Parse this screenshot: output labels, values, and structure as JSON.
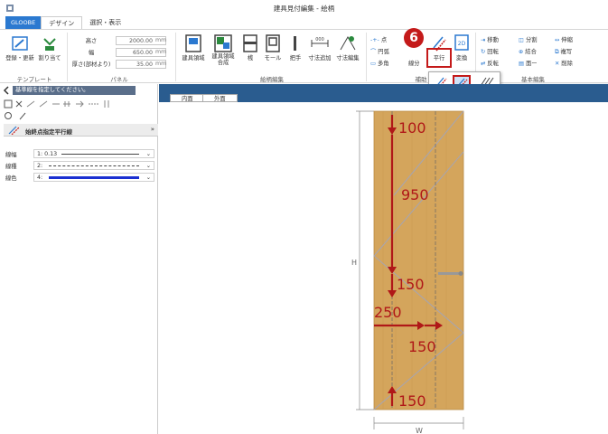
{
  "window": {
    "title": "建具見付編集 - 絵柄"
  },
  "tabs": {
    "file": "GLOOBE",
    "design": "デザイン",
    "view": "選択・表示"
  },
  "ribbon": {
    "template": {
      "register_label": "登録・更新",
      "assign_label": "割り当て",
      "group": "テンプレート"
    },
    "panel": {
      "height_label": "高さ",
      "height_value": "2000.00",
      "width_label": "幅",
      "width_value": "650.00",
      "thickness_label": "厚さ(部材より)",
      "thickness_value": "35.00",
      "unit": "mm",
      "group": "パネル"
    },
    "pattern": {
      "area_label": "建具領域",
      "area_composite_label": "建具領域\n合成",
      "frame_label": "桟",
      "mold_label": "モール",
      "handle_label": "把手",
      "dim_add_label": "寸法追加",
      "dim_edit_label": "寸法編集",
      "group": "絵柄編集"
    },
    "aux": {
      "point_label": "点",
      "arc_label": "円弧",
      "polygon_label": "多角",
      "parallel_label": "平行",
      "convert_label": "変換",
      "dir_label": "線分",
      "group": "補助"
    },
    "basic": {
      "move": "移動",
      "rotate": "回転",
      "reverse": "反転",
      "split": "分割",
      "join": "結合",
      "face": "面ー",
      "extend": "伸縮",
      "copy": "複写",
      "delete": "削除",
      "group": "基本編集"
    }
  },
  "step_badge": "6",
  "left": {
    "prompt": "基準線を指定してください。",
    "property_title": "始終点指定平行線",
    "rows": [
      {
        "key": "線幅",
        "value": "1: 0.13"
      },
      {
        "key": "線種",
        "value": "2:"
      },
      {
        "key": "線色",
        "value": "4:"
      }
    ]
  },
  "canvas": {
    "tabs": [
      "内面",
      "外面"
    ],
    "dims": [
      "100",
      "950",
      "150",
      "250",
      "150",
      "150"
    ],
    "h_label": "H",
    "w_label": "W"
  },
  "colors": {
    "accent": "#c41a1a",
    "door": "#d4a55c",
    "file_tab": "#2b79d0",
    "canvas_bar": "#2a5c8f"
  }
}
